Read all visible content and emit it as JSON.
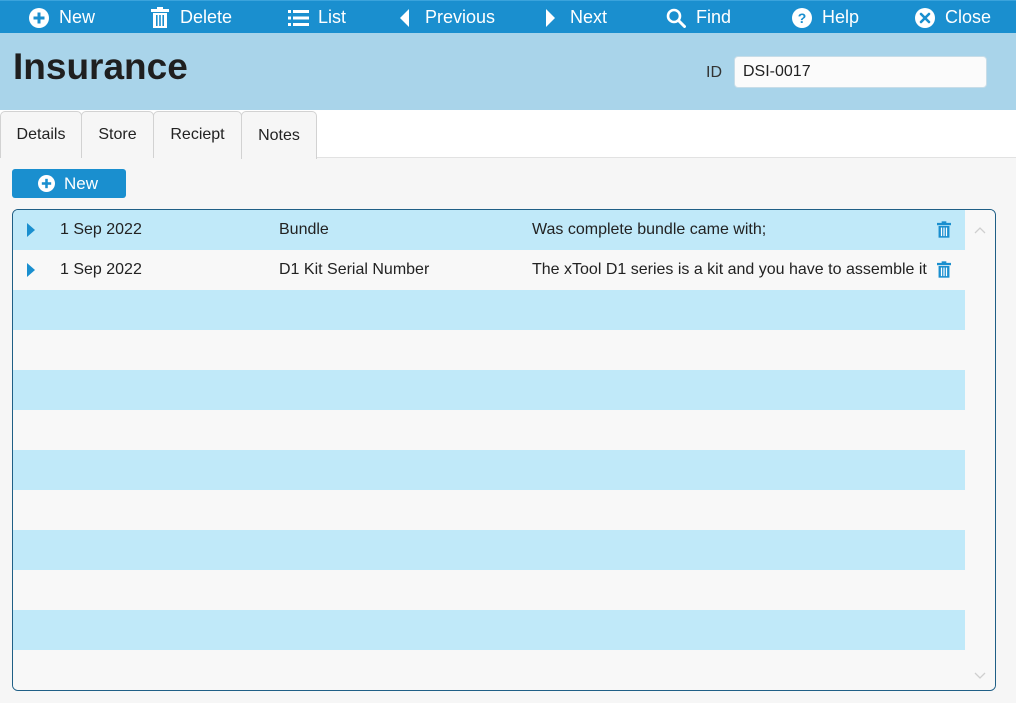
{
  "toolbar": {
    "new": {
      "label": "New",
      "icon": "plus-circle-icon"
    },
    "delete": {
      "label": "Delete",
      "icon": "trash-icon"
    },
    "list": {
      "label": "List",
      "icon": "list-icon"
    },
    "previous": {
      "label": "Previous",
      "icon": "chevron-left-icon"
    },
    "next": {
      "label": "Next",
      "icon": "chevron-right-icon"
    },
    "find": {
      "label": "Find",
      "icon": "search-icon"
    },
    "help": {
      "label": "Help",
      "icon": "help-circle-icon"
    },
    "close": {
      "label": "Close",
      "icon": "close-circle-icon"
    }
  },
  "header": {
    "title": "Insurance",
    "id_label": "ID",
    "id_value": "DSI-0017"
  },
  "tabs": [
    {
      "label": "Details"
    },
    {
      "label": "Store"
    },
    {
      "label": "Reciept"
    },
    {
      "label": "Notes",
      "active": true
    }
  ],
  "notes": {
    "new_label": "New",
    "rows": [
      {
        "date": "1 Sep 2022",
        "subject": "Bundle",
        "note": "Was complete bundle came with;"
      },
      {
        "date": "1 Sep 2022",
        "subject": "D1 Kit Serial Number",
        "note": "The xTool D1 series is a kit and you have to assemble it"
      }
    ],
    "empty_rows": 10
  },
  "colors": {
    "accent": "#1a8fcf",
    "header_bg": "#a9d4ea",
    "row_blue": "#c0e9f9",
    "row_grey": "#f8f8f8",
    "grid_border": "#1f5f86"
  }
}
